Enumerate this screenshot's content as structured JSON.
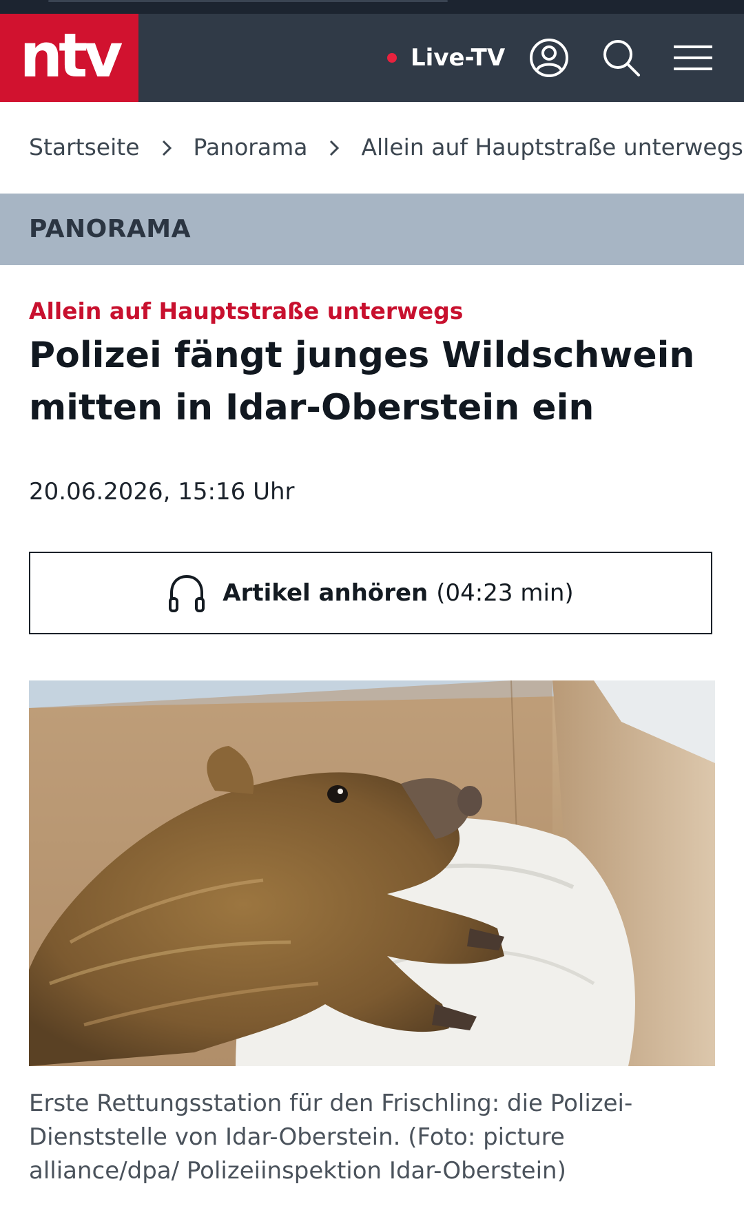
{
  "header": {
    "logo": "ntv",
    "live_label": "Live-TV",
    "icons": [
      "account-icon",
      "search-icon",
      "menu-icon"
    ],
    "brand_color": "#d1122f",
    "bar_color": "#303a47"
  },
  "breadcrumb": {
    "items": [
      "Startseite",
      "Panorama",
      "Allein auf Hauptstraße unterwegs: P"
    ]
  },
  "section": {
    "label": "PANORAMA"
  },
  "article": {
    "kicker": "Allein auf Hauptstraße unterwegs",
    "headline": "Polizei fängt junges Wildschwein mitten in Idar-Oberstein ein",
    "date": "20.06.2026, 15:16 Uhr",
    "listen": {
      "label": "Artikel anhören",
      "duration": "(04:23 min)"
    },
    "caption": "Erste Rettungsstation für den Frischling: die Polizei-Dienststelle von Idar-Oberstein. (Foto: picture alliance/dpa/ Polizeiinspektion Idar-Oberstein)"
  }
}
